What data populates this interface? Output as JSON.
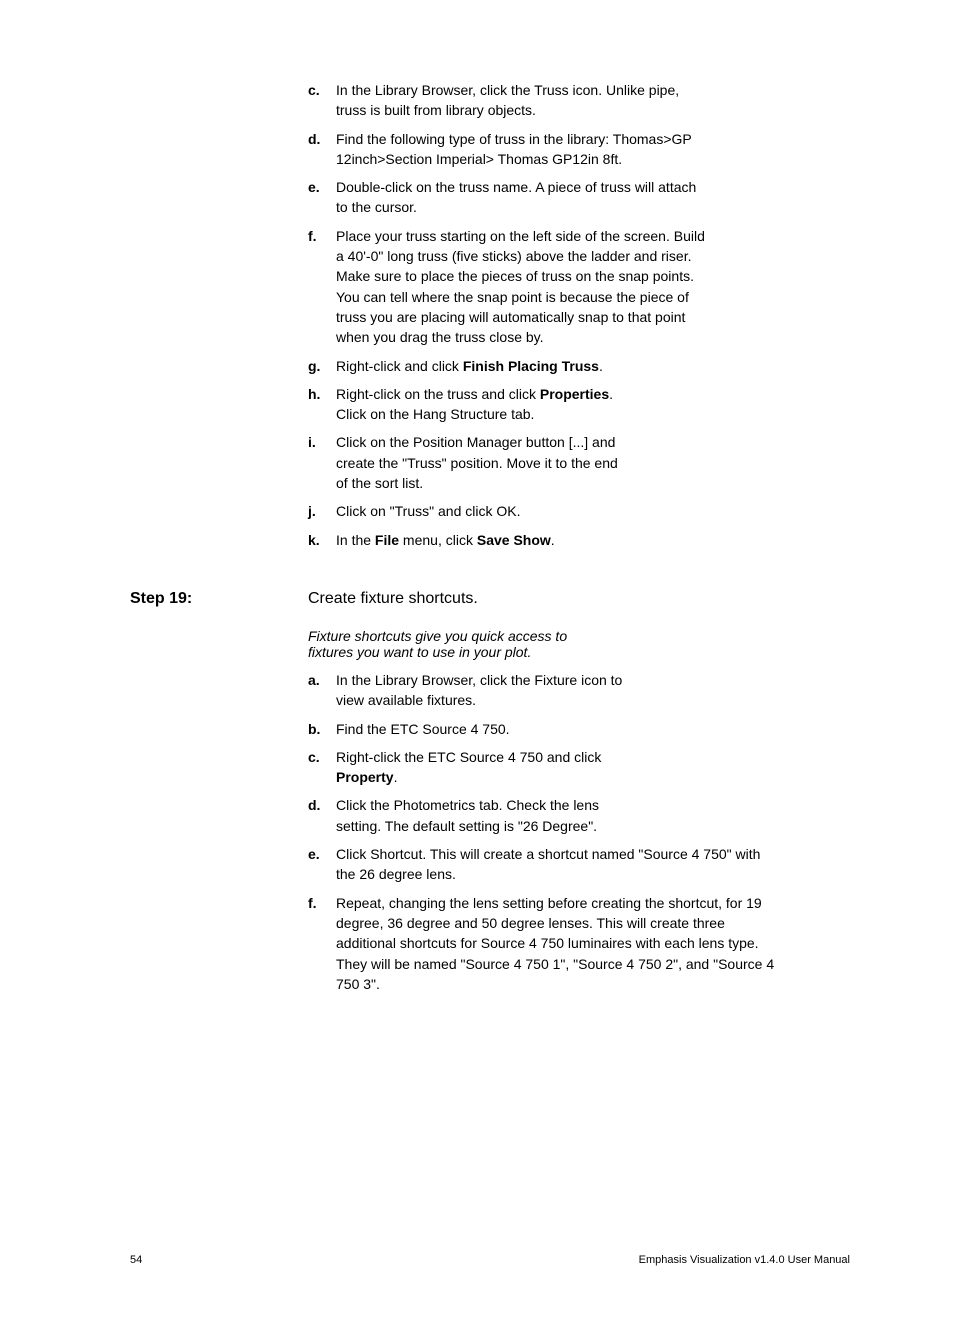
{
  "step18": {
    "items": [
      {
        "letter": "c.",
        "class": "narrow",
        "text": "In the Library Browser, click the Truss icon. Unlike pipe, truss is built from library objects."
      },
      {
        "letter": "d.",
        "class": "narrow",
        "text": "Find the following type of truss in the library: Thomas>GP 12inch>Section Imperial> Thomas GP12in 8ft."
      },
      {
        "letter": "e.",
        "class": "narrow",
        "text": "Double-click on the truss name. A piece of truss will attach to the cursor."
      },
      {
        "letter": "f.",
        "class": "narrow",
        "text": "Place your truss starting on the left side of the screen. Build a 40'-0\" long truss (five sticks) above the ladder and riser. Make sure to place the pieces of truss on the snap points. You can tell where the snap point is because the piece of truss you are placing will automatically snap to that point when you drag the truss close by."
      },
      {
        "letter": "g.",
        "class": "narrow",
        "html": "Right-click and click <b>Finish Placing Truss</b>."
      },
      {
        "letter": "h.",
        "class": "mid",
        "html": "Right-click on the truss and click <b>Properties</b>. Click on the Hang Structure tab."
      },
      {
        "letter": "i.",
        "class": "mid",
        "text": "Click on the Position Manager button [...] and create the \"Truss\" position. Move it to the end of the sort list."
      },
      {
        "letter": "j.",
        "class": "mid",
        "text": "Click on \"Truss\" and click OK."
      },
      {
        "letter": "k.",
        "class": "mid",
        "html": "In the <b>File</b> menu, click <b>Save Show</b>."
      }
    ]
  },
  "step19": {
    "label": "Step 19:",
    "title": "Create fixture shortcuts.",
    "intro": "Fixture shortcuts give you quick access to fixtures you want to use in your plot.",
    "items": [
      {
        "letter": "a.",
        "class": "mid",
        "text": "In the Library Browser, click the Fixture icon to view available fixtures."
      },
      {
        "letter": "b.",
        "class": "mid",
        "text": "Find the ETC Source 4 750."
      },
      {
        "letter": "c.",
        "class": "mid",
        "html": "Right-click the ETC Source 4 750 and click <b>Property</b>."
      },
      {
        "letter": "d.",
        "class": "mid",
        "text": "Click the Photometrics tab. Check the lens setting. The default setting is \"26 Degree\"."
      },
      {
        "letter": "e.",
        "class": "wide",
        "text": "Click Shortcut. This will create a shortcut named \"Source 4 750\" with the 26 degree lens."
      },
      {
        "letter": "f.",
        "class": "wide",
        "text": "Repeat, changing the lens setting before creating the shortcut, for 19 degree, 36 degree and 50 degree lenses. This will create three additional shortcuts for Source 4 750 luminaires with each lens type. They will be named \"Source 4 750 1\", \"Source 4 750 2\", and \"Source 4 750 3\"."
      }
    ]
  },
  "footer": {
    "page": "54",
    "title": "Emphasis Visualization v1.4.0 User Manual"
  }
}
